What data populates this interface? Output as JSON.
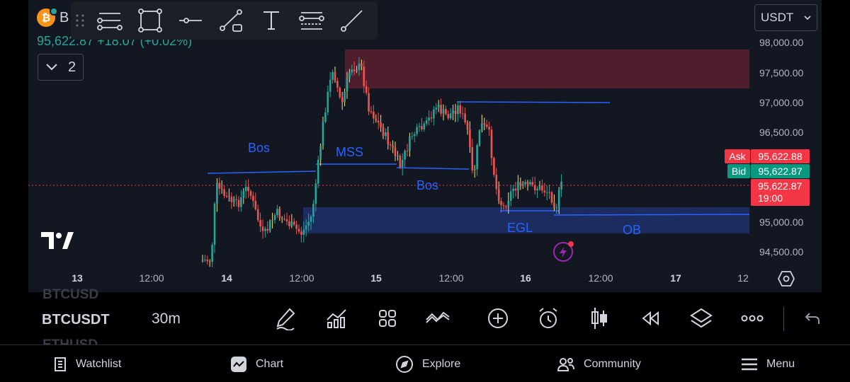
{
  "header": {
    "symbol_short": "B",
    "price_change": "95,622.87  +18.07 (+0.02%)",
    "collapse_count": "2"
  },
  "currency_select": {
    "value": "USDT"
  },
  "drawing_tools": [
    {
      "name": "trend-line-tool-icon"
    },
    {
      "name": "rectangle-tool-icon"
    },
    {
      "name": "horizontal-line-tool-icon"
    },
    {
      "name": "path-tool-icon"
    },
    {
      "name": "text-tool-icon"
    },
    {
      "name": "fib-tool-icon"
    },
    {
      "name": "ray-tool-icon"
    }
  ],
  "price_axis": [
    "98,000.00",
    "97,500.00",
    "97,000.00",
    "96,500.00",
    "95,000.00",
    "94,500.00"
  ],
  "time_axis": [
    {
      "label": "13",
      "bold": true
    },
    {
      "label": "12:00",
      "bold": false
    },
    {
      "label": "14",
      "bold": true
    },
    {
      "label": "12:00",
      "bold": false
    },
    {
      "label": "15",
      "bold": true
    },
    {
      "label": "12:00",
      "bold": false
    },
    {
      "label": "16",
      "bold": true
    },
    {
      "label": "12:00",
      "bold": false
    },
    {
      "label": "17",
      "bold": true
    },
    {
      "label": "12",
      "bold": false
    }
  ],
  "quote": {
    "ask_label": "Ask",
    "ask_value": "95,622.88",
    "bid_label": "Bid",
    "bid_value": "95,622.87",
    "last_price": "95,622.87",
    "countdown": "19:00"
  },
  "annotations": {
    "bos1": "Bos",
    "mss": "MSS",
    "bos2": "Bos",
    "egl": "EGL",
    "ob": "OB"
  },
  "bottom_toolbar": {
    "prev_symbol": "BTCUSD",
    "symbol": "BTCUSDT",
    "next_symbol": "ETHUSD",
    "interval": "30m"
  },
  "bottom_nav": [
    {
      "label": "Watchlist",
      "icon": "watchlist-icon"
    },
    {
      "label": "Chart",
      "icon": "chart-icon"
    },
    {
      "label": "Explore",
      "icon": "compass-icon"
    },
    {
      "label": "Community",
      "icon": "community-icon"
    },
    {
      "label": "Menu",
      "icon": "menu-icon"
    }
  ],
  "colors": {
    "up": "#26a69a",
    "down": "#ef5350",
    "wick_accent": "#f6e27a",
    "drawing": "#2962ff",
    "background": "#131722",
    "supply_zone": "#5c1f2e",
    "demand_zone": "#1e2f66"
  }
}
